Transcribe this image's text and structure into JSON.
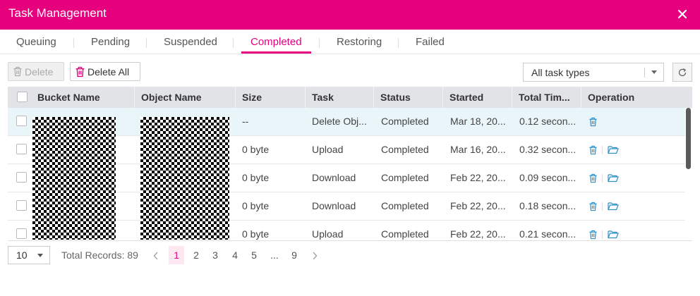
{
  "window": {
    "title": "Task Management"
  },
  "tabs": [
    {
      "label": "Queuing"
    },
    {
      "label": "Pending"
    },
    {
      "label": "Suspended"
    },
    {
      "label": "Completed"
    },
    {
      "label": "Restoring"
    },
    {
      "label": "Failed"
    }
  ],
  "active_tab": "Completed",
  "toolbar": {
    "delete_label": "Delete",
    "delete_all_label": "Delete All",
    "task_type_value": "All task types"
  },
  "table": {
    "columns": [
      "Bucket Name",
      "Object Name",
      "Size",
      "Task",
      "Status",
      "Started",
      "Total Tim...",
      "Operation"
    ],
    "rows": [
      {
        "size": "--",
        "task": "Delete Obj...",
        "status": "Completed",
        "started": "Mar 18, 20...",
        "total_time": "0.12 secon...",
        "selected": true,
        "operations": [
          "trash-icon"
        ]
      },
      {
        "size": "0 byte",
        "task": "Upload",
        "status": "Completed",
        "started": "Mar 16, 20...",
        "total_time": "0.32 secon...",
        "selected": false,
        "operations": [
          "trash-icon",
          "folder-icon"
        ]
      },
      {
        "size": "0 byte",
        "task": "Download",
        "status": "Completed",
        "started": "Feb 22, 20...",
        "total_time": "0.09 secon...",
        "selected": false,
        "operations": [
          "trash-icon",
          "folder-icon"
        ]
      },
      {
        "size": "0 byte",
        "task": "Download",
        "status": "Completed",
        "started": "Feb 22, 20...",
        "total_time": "0.18 secon...",
        "selected": false,
        "operations": [
          "trash-icon",
          "folder-icon"
        ]
      },
      {
        "size": "0 byte",
        "task": "Upload",
        "status": "Completed",
        "started": "Feb 22, 20...",
        "total_time": "0.21 secon...",
        "selected": false,
        "operations": [
          "trash-icon",
          "folder-icon"
        ]
      }
    ]
  },
  "pagination": {
    "page_size": "10",
    "total_records": "Total Records: 89",
    "pages": [
      "1",
      "2",
      "3",
      "4",
      "5",
      "...",
      "9"
    ],
    "current_page": "1"
  },
  "colors": {
    "accent": "#e6007e",
    "icon_blue": "#2f8fc7",
    "selected_row": "#e9f5f9",
    "header_bg": "#e1e3e6"
  }
}
